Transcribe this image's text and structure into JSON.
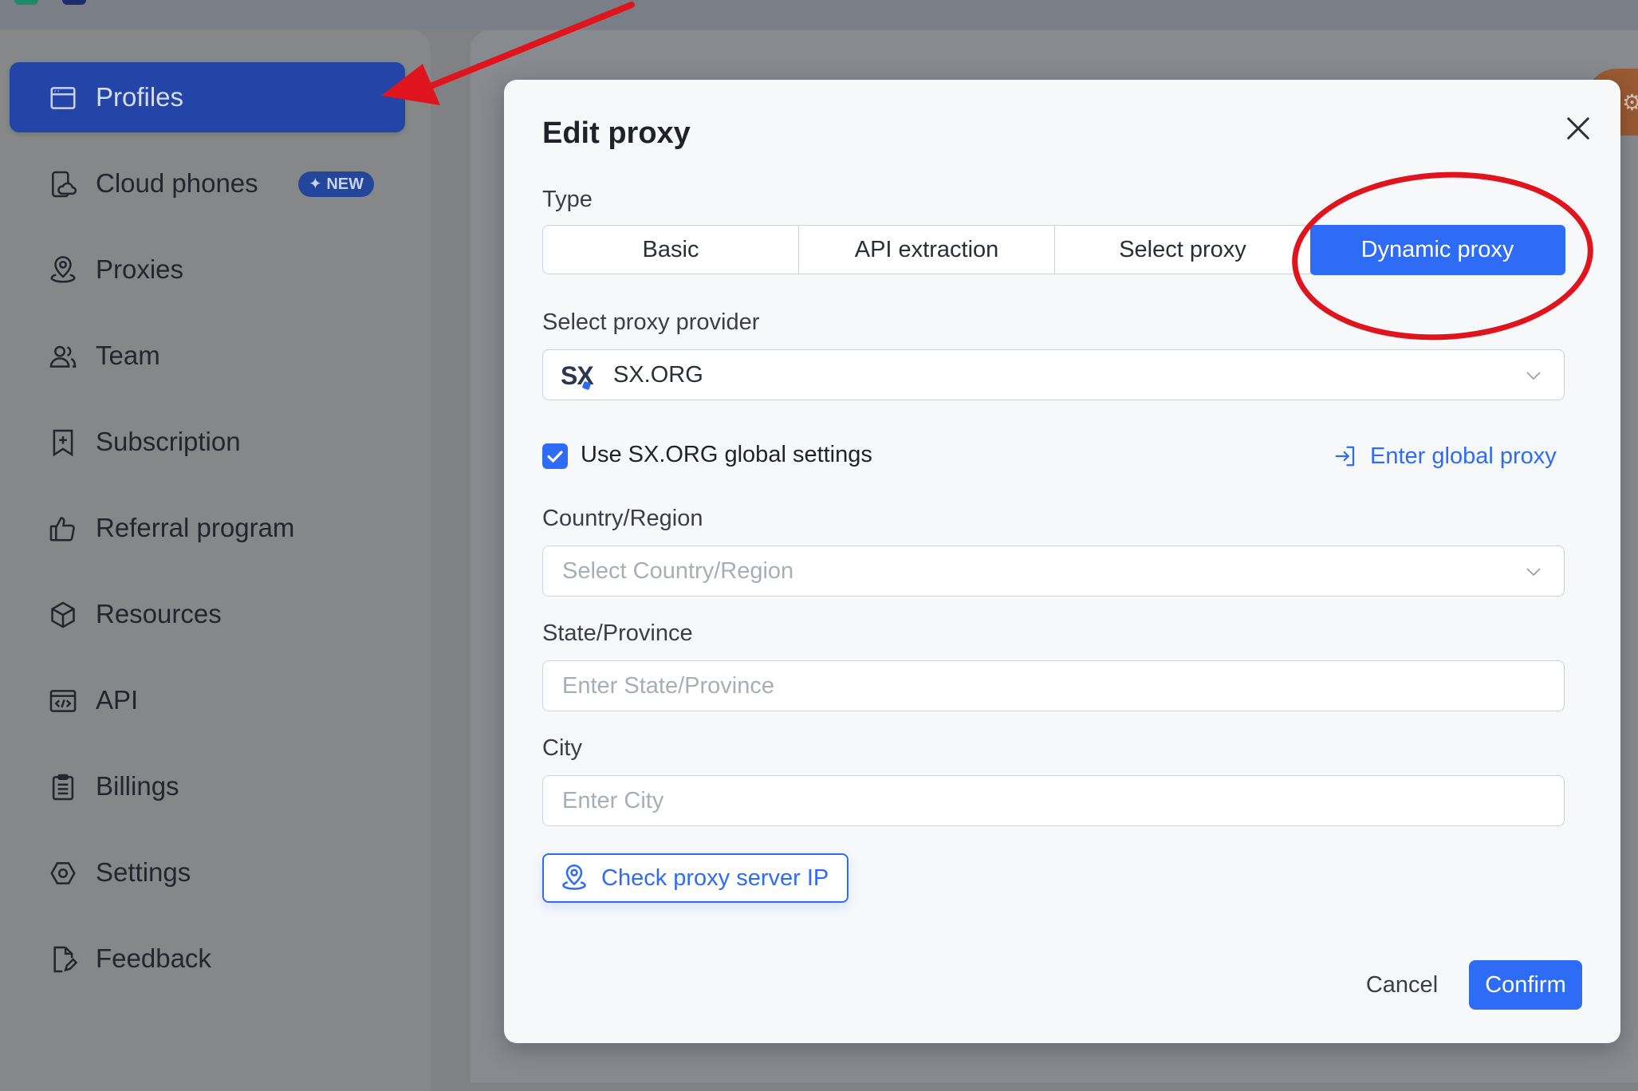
{
  "sidebar": {
    "items": [
      {
        "label": "Profiles",
        "icon": "browser-window-icon",
        "active": true
      },
      {
        "label": "Cloud phones",
        "icon": "cloud-phone-icon",
        "badge": "NEW"
      },
      {
        "label": "Proxies",
        "icon": "location-pin-icon"
      },
      {
        "label": "Team",
        "icon": "team-icon"
      },
      {
        "label": "Subscription",
        "icon": "bookmark-plus-icon"
      },
      {
        "label": "Referral program",
        "icon": "thumbs-up-icon"
      },
      {
        "label": "Resources",
        "icon": "cube-icon"
      },
      {
        "label": "API",
        "icon": "code-window-icon"
      },
      {
        "label": "Billings",
        "icon": "clipboard-icon"
      },
      {
        "label": "Settings",
        "icon": "gear-hexagon-icon"
      },
      {
        "label": "Feedback",
        "icon": "edit-document-icon"
      }
    ]
  },
  "modal": {
    "title": "Edit proxy",
    "type_label": "Type",
    "type_options": [
      "Basic",
      "API extraction",
      "Select proxy",
      "Dynamic proxy"
    ],
    "type_selected": "Dynamic proxy",
    "provider_label": "Select proxy provider",
    "provider_logo": "SX",
    "provider_value": "SX.ORG",
    "use_global_label": "Use SX.ORG global settings",
    "use_global_checked": true,
    "enter_global_link": "Enter global proxy",
    "country_label": "Country/Region",
    "country_placeholder": "Select Country/Region",
    "state_label": "State/Province",
    "state_placeholder": "Enter State/Province",
    "city_label": "City",
    "city_placeholder": "Enter City",
    "check_ip_label": "Check proxy server IP",
    "cancel_label": "Cancel",
    "confirm_label": "Confirm"
  },
  "colors": {
    "accent": "#2f6cf5",
    "sidebar_active": "#2345a8",
    "annotation_red": "#e0141c"
  }
}
